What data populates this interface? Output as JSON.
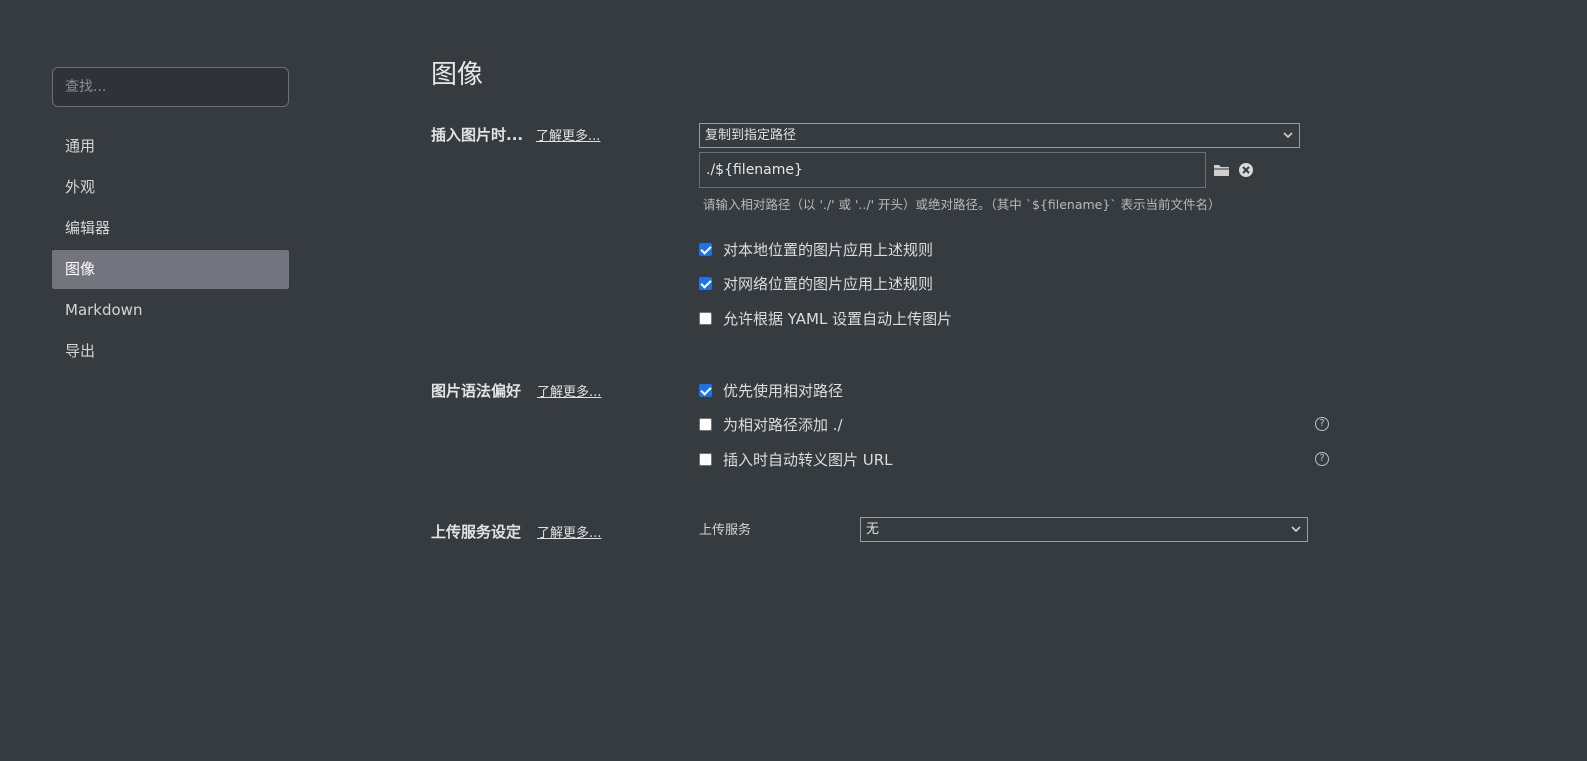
{
  "sidebar": {
    "search_placeholder": "查找...",
    "items": [
      {
        "label": "通用"
      },
      {
        "label": "外观"
      },
      {
        "label": "编辑器"
      },
      {
        "label": "图像"
      },
      {
        "label": "Markdown"
      },
      {
        "label": "导出"
      }
    ],
    "active_item": "图像"
  },
  "page": {
    "title": "图像"
  },
  "insert_section": {
    "label": "插入图片时...",
    "learn_more": "了解更多...",
    "action_select": "复制到指定路径",
    "path_value": "./${filename}",
    "hint": "请输入相对路径（以 './' 或 '../' 开头）或绝对路径。（其中 `${filename}` 表示当前文件名）",
    "icons": {
      "folder": "folder-icon",
      "clear": "clear-icon"
    },
    "checks": [
      {
        "label": "对本地位置的图片应用上述规则",
        "checked": true
      },
      {
        "label": "对网络位置的图片应用上述规则",
        "checked": true
      },
      {
        "label": "允许根据 YAML 设置自动上传图片",
        "checked": false
      }
    ]
  },
  "syntax_section": {
    "label": "图片语法偏好",
    "learn_more": "了解更多...",
    "checks": [
      {
        "label": "优先使用相对路径",
        "checked": true
      },
      {
        "label": "为相对路径添加 ./",
        "checked": false
      },
      {
        "label": "插入时自动转义图片 URL",
        "checked": false
      }
    ],
    "help_glyph": "?"
  },
  "upload_section": {
    "label": "上传服务设定",
    "learn_more": "了解更多...",
    "service_label": "上传服务",
    "service_value": "无"
  },
  "colors": {
    "background": "#363b40",
    "active_nav": "#74747f",
    "checkbox_on": "#1a73e8"
  }
}
